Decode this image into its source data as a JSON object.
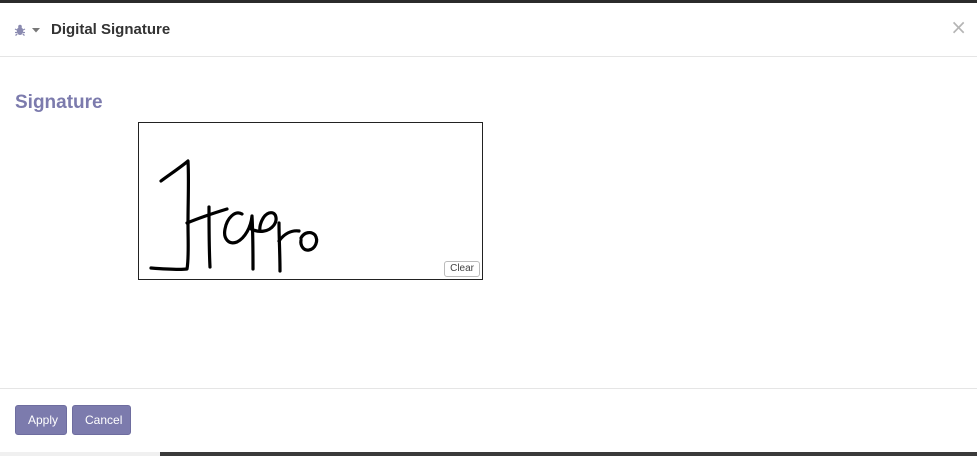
{
  "dialog": {
    "title": "Digital Signature",
    "close_glyph": "×",
    "debug_icon": "bug-icon"
  },
  "body": {
    "section_title": "Signature",
    "clear_label": "Clear"
  },
  "footer": {
    "apply_label": "Apply",
    "cancel_label": "Cancel"
  },
  "colors": {
    "accent": "#7c7bad",
    "title_text": "#333333"
  }
}
